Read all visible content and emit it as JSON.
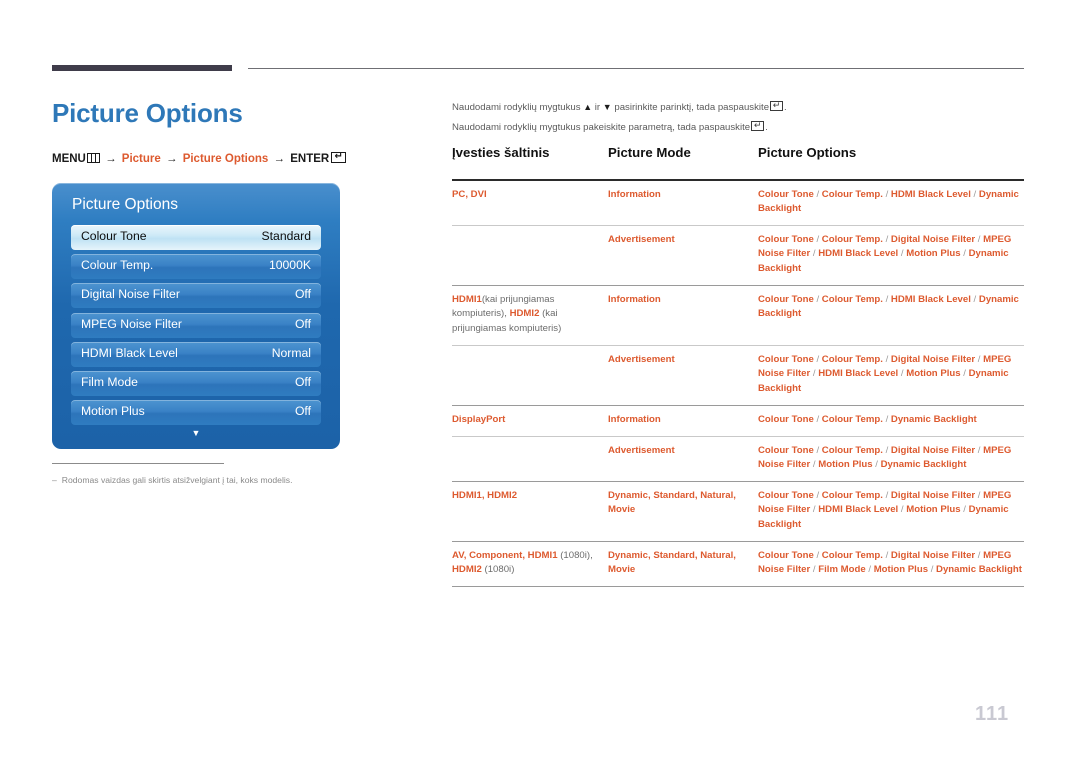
{
  "page_title": "Picture Options",
  "breadcrumb": {
    "menu_label": "MENU",
    "menu_icon": "menu-grid-icon",
    "arrow": "→",
    "item1": "Picture",
    "item2": "Picture Options",
    "enter_label": "ENTER",
    "enter_icon": "enter-key-icon"
  },
  "osd": {
    "title": "Picture Options",
    "rows": [
      {
        "label": "Colour Tone",
        "value": "Standard",
        "selected": true
      },
      {
        "label": "Colour Temp.",
        "value": "10000K",
        "selected": false
      },
      {
        "label": "Digital Noise Filter",
        "value": "Off",
        "selected": false
      },
      {
        "label": "MPEG Noise Filter",
        "value": "Off",
        "selected": false
      },
      {
        "label": "HDMI Black Level",
        "value": "Normal",
        "selected": false
      },
      {
        "label": "Film Mode",
        "value": "Off",
        "selected": false
      },
      {
        "label": "Motion Plus",
        "value": "Off",
        "selected": false
      }
    ],
    "scroll_arrow": "▼"
  },
  "footnote": {
    "dash": "–",
    "text": "Rodomas vaizdas gali skirtis atsižvelgiant į tai, koks modelis."
  },
  "intro": {
    "line1_a": "Naudodami rodyklių mygtukus",
    "line1_up": "▲",
    "line1_b": "ir",
    "line1_down": "▼",
    "line1_c": "pasirinkite parinktį, tada paspauskite",
    "line1_d": ".",
    "line2_a": "Naudodami rodyklių mygtukus pakeiskite parametrą, tada paspauskite",
    "line2_b": "."
  },
  "table": {
    "headers": [
      "Įvesties šaltinis",
      "Picture Mode",
      "Picture Options"
    ],
    "groups": [
      {
        "source_main": "PC, DVI",
        "source_muted": "",
        "rows": [
          {
            "mode": "Information",
            "options": "Colour Tone / Colour Temp. / HDMI Black Level / Dynamic Backlight"
          },
          {
            "mode": "Advertisement",
            "options": "Colour Tone / Colour Temp. / Digital Noise Filter / MPEG Noise Filter / HDMI Black Level / Motion Plus / Dynamic Backlight"
          }
        ]
      },
      {
        "source_main": "HDMI1",
        "source_muted": "(kai prijungiamas kompiuteris), ",
        "source_main2": "HDMI2",
        "source_muted2": " (kai prijungiamas kompiuteris)",
        "rows": [
          {
            "mode": "Information",
            "options": "Colour Tone / Colour Temp. / HDMI Black Level / Dynamic Backlight"
          },
          {
            "mode": "Advertisement",
            "options": "Colour Tone / Colour Temp. / Digital Noise Filter / MPEG Noise Filter / HDMI Black Level / Motion Plus / Dynamic Backlight"
          }
        ]
      },
      {
        "source_main": "DisplayPort",
        "source_muted": "",
        "rows": [
          {
            "mode": "Information",
            "options": "Colour Tone / Colour Temp. / Dynamic Backlight"
          },
          {
            "mode": "Advertisement",
            "options": "Colour Tone / Colour Temp. / Digital Noise Filter / MPEG Noise Filter / Motion Plus / Dynamic Backlight"
          }
        ]
      },
      {
        "source_main": "HDMI1, HDMI2",
        "source_muted": "",
        "rows": [
          {
            "mode": "Dynamic, Standard, Natural, Movie",
            "options": "Colour Tone / Colour Temp. / Digital Noise Filter / MPEG Noise Filter / HDMI Black Level / Motion Plus / Dynamic Backlight"
          }
        ]
      },
      {
        "source_main": "AV, Component, HDMI1",
        "source_muted": " (1080i), ",
        "source_main2": "HDMI2",
        "source_muted2": " (1080i)",
        "rows": [
          {
            "mode": "Dynamic, Standard, Natural, Movie",
            "options": "Colour Tone / Colour Temp. / Digital Noise Filter / MPEG Noise Filter / Film Mode / Motion Plus / Dynamic Backlight"
          }
        ]
      }
    ]
  },
  "page_number": "111",
  "colors": {
    "accent_blue": "#2e78b8",
    "accent_orange": "#dd5a2f",
    "rule_dark": "#3f3c4a",
    "osd_blue": "#1f68ae",
    "page_number": "#c9c9d2"
  }
}
